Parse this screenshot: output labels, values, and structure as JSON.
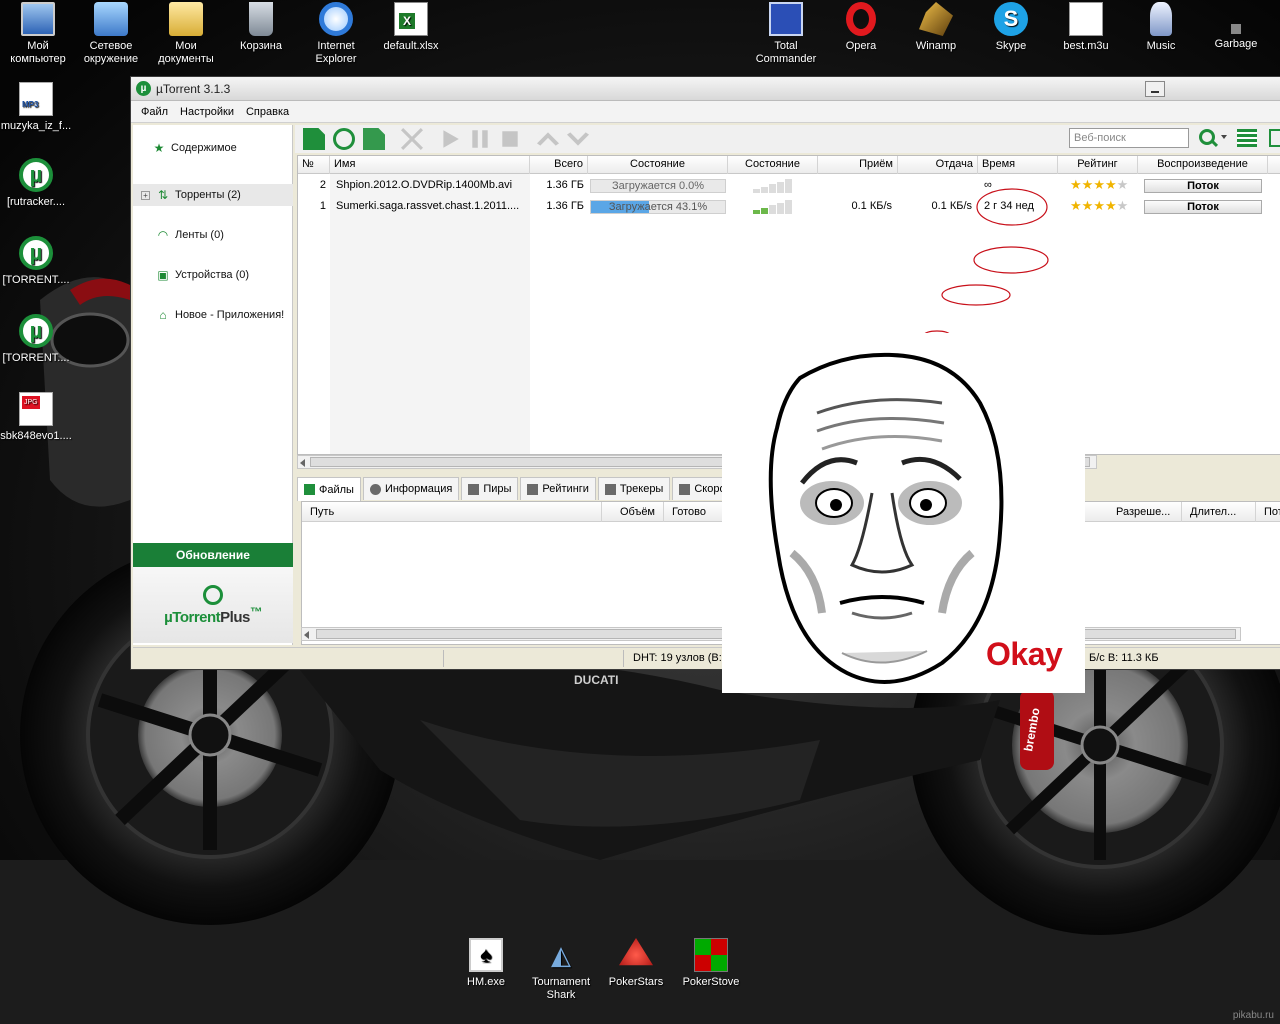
{
  "desktop": {
    "icons_top": [
      {
        "label": "Мой компьютер",
        "icon": "my-computer-icon"
      },
      {
        "label": "Сетевое окружение",
        "icon": "network-icon"
      },
      {
        "label": "Мои документы",
        "icon": "my-documents-icon"
      },
      {
        "label": "Корзина",
        "icon": "recycle-bin-icon"
      },
      {
        "label": "Internet Explorer",
        "icon": "internet-explorer-icon"
      },
      {
        "label": "default.xlsx",
        "icon": "excel-file-icon"
      }
    ],
    "icons_top_right": [
      {
        "label": "Total Commander",
        "icon": "total-commander-icon"
      },
      {
        "label": "Opera",
        "icon": "opera-icon"
      },
      {
        "label": "Winamp",
        "icon": "winamp-icon"
      },
      {
        "label": "Skype",
        "icon": "skype-icon"
      },
      {
        "label": "best.m3u",
        "icon": "playlist-file-icon"
      },
      {
        "label": "Music",
        "icon": "music-folder-icon"
      },
      {
        "label": "Garbage",
        "icon": "garbage-folder-icon"
      }
    ],
    "icons_left": [
      {
        "label": "muzyka_iz_f...",
        "icon": "mp3-file-icon"
      },
      {
        "label": "[rutracker....",
        "icon": "torrent-file-icon"
      },
      {
        "label": "[TORRENT....",
        "icon": "torrent-file-icon"
      },
      {
        "label": "[TORRENT....",
        "icon": "torrent-file-icon"
      },
      {
        "label": "sbk848evo1....",
        "icon": "jpg-file-icon"
      }
    ],
    "icons_bottom": [
      {
        "label": "HM.exe",
        "icon": "holdem-manager-icon"
      },
      {
        "label": "Tournament Shark",
        "icon": "tournament-shark-icon"
      },
      {
        "label": "PokerStars",
        "icon": "pokerstars-icon"
      },
      {
        "label": "PokerStove",
        "icon": "pokerstove-icon"
      }
    ],
    "wallpaper_text": "DUCATI",
    "brake_text": "brembo",
    "watermark": "pikabu.ru"
  },
  "window": {
    "title": "µTorrent 3.1.3",
    "title_logo": "µ",
    "menu": [
      "Файл",
      "Настройки",
      "Справка"
    ],
    "sidebar": {
      "items": [
        {
          "label": "Содержимое",
          "icon": "star-icon"
        },
        {
          "label": "Торренты (2)",
          "icon": "torrents-icon",
          "expander": "+"
        },
        {
          "label": "Ленты (0)",
          "icon": "rss-icon"
        },
        {
          "label": "Устройства (0)",
          "icon": "devices-icon"
        },
        {
          "label": "Новое - Приложения!",
          "icon": "apps-icon"
        }
      ],
      "update_label": "Обновление",
      "plus_logo_prefix": "µTorrent",
      "plus_logo_suffix": "Plus",
      "plus_logo_tm": "™"
    },
    "search_placeholder": "Веб-поиск",
    "columns": [
      "№",
      "Имя",
      "Всего",
      "Состояние",
      "Состояние",
      "Приём",
      "Отдача",
      "Время",
      "Рейтинг",
      "Воспроизведение"
    ],
    "torrents": [
      {
        "num": "2",
        "name": "Shpion.2012.O.DVDRip.1400Mb.avi",
        "size": "1.36 ГБ",
        "status": "Загружается 0.0%",
        "progress": 0.0,
        "health_bars": 0,
        "down": "",
        "up": "",
        "eta": "∞",
        "rating": 4,
        "play": "Поток"
      },
      {
        "num": "1",
        "name": "Sumerki.saga.rassvet.chast.1.2011....",
        "size": "1.36 ГБ",
        "status": "Загружается 43.1%",
        "progress": 43.1,
        "health_bars": 2,
        "down": "0.1 КБ/s",
        "up": "0.1 КБ/s",
        "eta": "2 г 34 нед",
        "rating": 4,
        "play": "Поток"
      }
    ],
    "detail_tabs": [
      "Файлы",
      "Информация",
      "Пиры",
      "Рейтинги",
      "Трекеры",
      "Скорость"
    ],
    "file_columns": [
      "Путь",
      "Объём",
      "Готово",
      "Разреше...",
      "Длител...",
      "Пото"
    ],
    "status": {
      "dht": "DHT: 19 узлов  (В:",
      "transfer": "Б/с В: 11.3 КБ"
    }
  },
  "meme": {
    "caption": "Okay"
  },
  "colors": {
    "utorrent_green": "#1a7f37",
    "progress_blue": "#5aa6e6",
    "okay_red": "#d10f1a"
  }
}
